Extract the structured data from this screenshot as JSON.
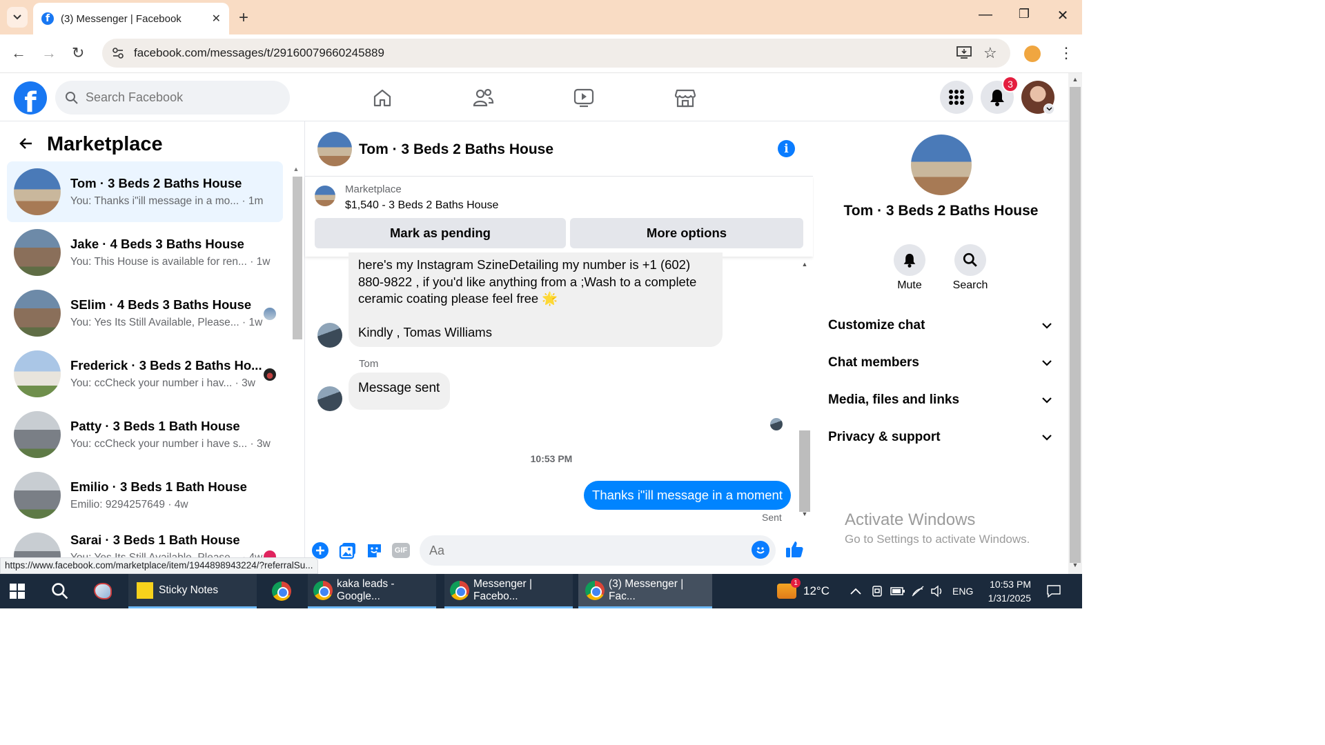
{
  "browser": {
    "tab_title": "(3) Messenger | Facebook",
    "url": "facebook.com/messages/t/29160079660245889",
    "status_url": "https://www.facebook.com/marketplace/item/1944898943224/?referralSu..."
  },
  "fb": {
    "search_placeholder": "Search Facebook",
    "notification_count": "3"
  },
  "left": {
    "title": "Marketplace",
    "conversations": [
      {
        "name": "Tom · 3 Beds 2 Baths House",
        "snippet": "You: Thanks i\"ill message in a mo...",
        "time": "· 1m"
      },
      {
        "name": "Jake · 4 Beds 3 Baths House",
        "snippet": "You: This House is available for ren...",
        "time": "· 1w"
      },
      {
        "name": "SElim · 4 Beds 3 Baths House",
        "snippet": "You: Yes Its Still Available, Please...",
        "time": "· 1w"
      },
      {
        "name": "Frederick · 3 Beds 2 Baths Ho...",
        "snippet": "You: ccCheck your number i hav...",
        "time": "· 3w"
      },
      {
        "name": "Patty · 3 Beds 1 Bath House",
        "snippet": "You: ccCheck your number i have s...",
        "time": "· 3w"
      },
      {
        "name": "Emilio · 3 Beds 1 Bath House",
        "snippet": "Emilio: 9294257649",
        "time": "· 4w"
      },
      {
        "name": "Sarai · 3 Beds 1 Bath House",
        "snippet": "You: Yes Its Still Available, Please...",
        "time": "· 4w"
      }
    ]
  },
  "chat": {
    "header_name": "Tom · 3 Beds 2 Baths House",
    "marketplace_label": "Marketplace",
    "listing": "$1,540 - 3 Beds 2 Baths House",
    "mark_pending": "Mark as pending",
    "more_options": "More options",
    "msg1_line1": "here's my Instagram SzineDetailing my number is +1 (602)",
    "msg1_line2": "880-9822 , if you'd like anything from a ;Wash to a complete",
    "msg1_line3": "ceramic coating please feel free",
    "msg1_emoji": "🌟",
    "msg1_sign": "Kindly , Tomas Williams",
    "sender_label": "Tom",
    "msg2": "Message sent",
    "timestamp": "10:53 PM",
    "msg_out": "Thanks i\"ill message in a moment",
    "sent_label": "Sent",
    "input_placeholder": "Aa"
  },
  "right": {
    "name": "Tom · 3 Beds 2 Baths House",
    "mute": "Mute",
    "search": "Search",
    "sections": [
      "Customize chat",
      "Chat members",
      "Media, files and links",
      "Privacy & support"
    ],
    "activate_title": "Activate Windows",
    "activate_sub": "Go to Settings to activate Windows."
  },
  "taskbar": {
    "sticky": "Sticky Notes",
    "chrome1": "kaka leads - Google...",
    "chrome2": "Messenger | Facebo...",
    "chrome3": "(3) Messenger | Fac...",
    "weather_badge": "1",
    "temp": "12°C",
    "lang": "ENG",
    "time": "10:53 PM",
    "date": "1/31/2025"
  }
}
